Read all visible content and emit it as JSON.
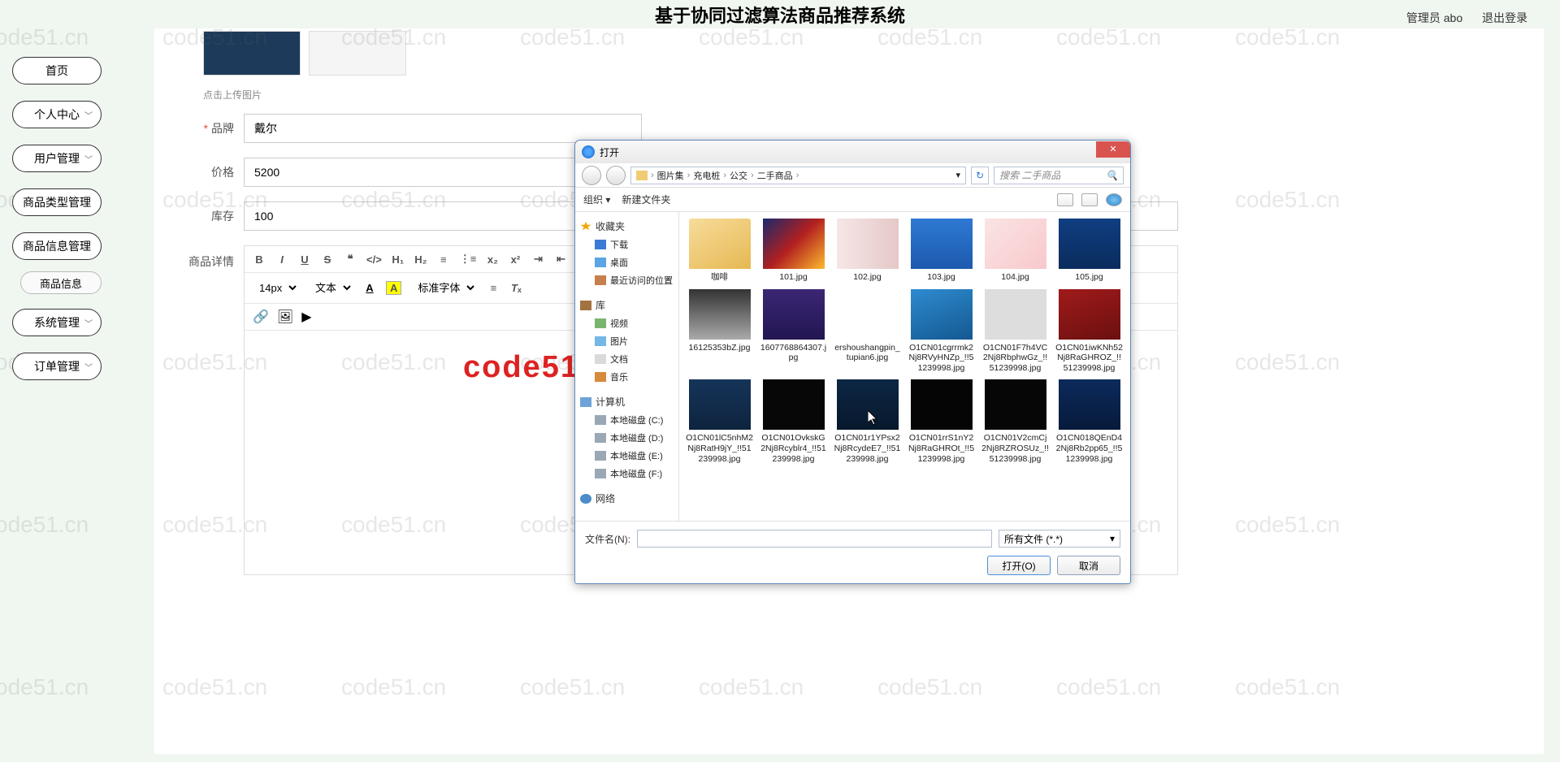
{
  "header": {
    "title": "基于协同过滤算法商品推荐系统",
    "admin_label": "管理员 abo",
    "logout": "退出登录"
  },
  "sidebar": {
    "items": [
      {
        "label": "首页",
        "has_sub": false
      },
      {
        "label": "个人中心",
        "has_sub": true
      },
      {
        "label": "用户管理",
        "has_sub": true
      },
      {
        "label": "商品类型管理",
        "has_sub": false
      },
      {
        "label": "商品信息管理",
        "has_sub": false
      },
      {
        "label": "系统管理",
        "has_sub": true
      },
      {
        "label": "订单管理",
        "has_sub": true
      }
    ],
    "sub_item": "商品信息"
  },
  "form": {
    "upload_hint": "点击上传图片",
    "brand_label": "品牌",
    "brand_value": "戴尔",
    "price_label": "价格",
    "price_value": "5200",
    "stock_label": "库存",
    "stock_value": "100",
    "detail_label": "商品详情"
  },
  "editor": {
    "fontsize": "14px",
    "font_label": "文本",
    "stdfont": "标准字体"
  },
  "dialog": {
    "title": "打开",
    "breadcrumb": [
      "图片集",
      "充电桩",
      "公交",
      "二手商品"
    ],
    "search_placeholder": "搜索 二手商品",
    "organize": "组织 ▾",
    "new_folder": "新建文件夹",
    "tree": {
      "fav": "收藏夹",
      "download": "下载",
      "desktop": "桌面",
      "recent": "最近访问的位置",
      "library": "库",
      "video": "视频",
      "picture": "图片",
      "document": "文档",
      "music": "音乐",
      "computer": "计算机",
      "disk_c": "本地磁盘 (C:)",
      "disk_d": "本地磁盘 (D:)",
      "disk_e": "本地磁盘 (E:)",
      "disk_f": "本地磁盘 (F:)",
      "network": "网络"
    },
    "files": [
      {
        "name": "咖啡",
        "folder": true
      },
      {
        "name": "101.jpg",
        "cls": "thumb-c101"
      },
      {
        "name": "102.jpg",
        "cls": "thumb-c102"
      },
      {
        "name": "103.jpg",
        "cls": "thumb-c103"
      },
      {
        "name": "104.jpg",
        "cls": "thumb-c104"
      },
      {
        "name": "105.jpg",
        "cls": "thumb-c105"
      },
      {
        "name": "16125353bZ.jpg",
        "cls": "thumb-c201"
      },
      {
        "name": "1607768864307.jpg",
        "cls": "thumb-c202"
      },
      {
        "name": "ershoushangpin_tupian6.jpg",
        "cls": "thumb-c203"
      },
      {
        "name": "O1CN01cgrrmk2Nj8RVyHNZp_!!51239998.jpg",
        "cls": "thumb-c204"
      },
      {
        "name": "O1CN01F7h4VC2Nj8RbphwGz_!!51239998.jpg",
        "cls": "thumb-c205"
      },
      {
        "name": "O1CN01iwKNh52Nj8RaGHROZ_!!51239998.jpg",
        "cls": "thumb-c206"
      },
      {
        "name": "O1CN01lC5nhM2Nj8RatH9jY_!!51239998.jpg",
        "cls": "thumb-c301"
      },
      {
        "name": "O1CN01OvkskG2Nj8Rcyblr4_!!51239998.jpg",
        "cls": "thumb-c302"
      },
      {
        "name": "O1CN01r1YPsx2Nj8RcydeE7_!!51239998.jpg",
        "cls": "thumb-c303"
      },
      {
        "name": "O1CN01rrS1nY2Nj8RaGHROt_!!51239998.jpg",
        "cls": "thumb-c304"
      },
      {
        "name": "O1CN01V2cmCj2Nj8RZROSUz_!!51239998.jpg",
        "cls": "thumb-c305"
      },
      {
        "name": "O1CN018QEnD42Nj8Rb2pp65_!!51239998.jpg",
        "cls": "thumb-c306"
      }
    ],
    "filename_label": "文件名(N):",
    "filter": "所有文件 (*.*)",
    "open_btn": "打开(O)",
    "cancel_btn": "取消"
  },
  "overlay_text": "code51. cn-源码乐园盗图必究",
  "watermark_text": "code51.cn"
}
